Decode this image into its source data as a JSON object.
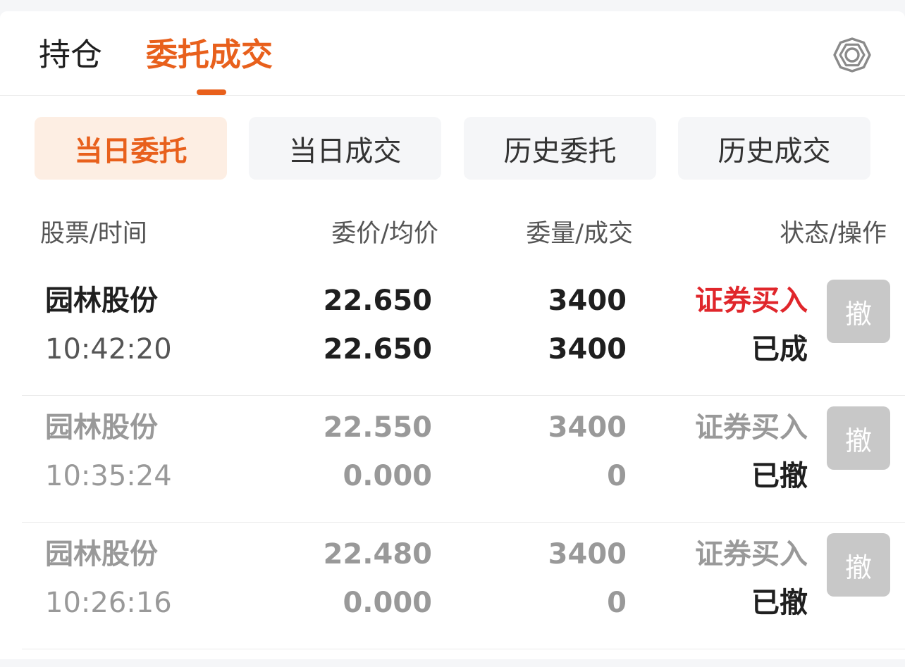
{
  "main_tabs": [
    {
      "label": "持仓"
    },
    {
      "label": "委托成交"
    }
  ],
  "sub_tabs": [
    {
      "label": "当日委托"
    },
    {
      "label": "当日成交"
    },
    {
      "label": "历史委托"
    },
    {
      "label": "历史成交"
    }
  ],
  "columns": [
    "股票/时间",
    "委价/均价",
    "委量/成交",
    "状态/操作"
  ],
  "orders": [
    {
      "stock": "园林股份",
      "time": "10:42:20",
      "order_price": "22.650",
      "avg_price": "22.650",
      "order_qty": "3400",
      "filled_qty": "3400",
      "operation": "证券买入",
      "status": "已成",
      "cancel_label": "撤"
    },
    {
      "stock": "园林股份",
      "time": "10:35:24",
      "order_price": "22.550",
      "avg_price": "0.000",
      "order_qty": "3400",
      "filled_qty": "0",
      "operation": "证券买入",
      "status": "已撤",
      "cancel_label": "撤"
    },
    {
      "stock": "园林股份",
      "time": "10:26:16",
      "order_price": "22.480",
      "avg_price": "0.000",
      "order_qty": "3400",
      "filled_qty": "0",
      "operation": "证券买入",
      "status": "已撤",
      "cancel_label": "撤"
    }
  ],
  "icons": {
    "settings": "gear-icon"
  },
  "colors": {
    "accent": "#e8601c",
    "buy": "#e0262b",
    "muted": "#999999"
  }
}
